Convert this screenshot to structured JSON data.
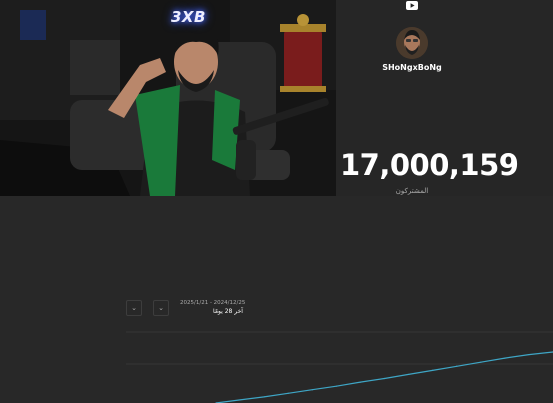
{
  "photo": {
    "logo_text": "3XB"
  },
  "channel": {
    "platform_icon": "youtube-icon",
    "name": "SHoNgxBoNg",
    "subscriber_count": "17,000,159",
    "subscriber_label": "المشتركون"
  },
  "range": {
    "dates": "2025/1/21 - 2024/12/25",
    "label": "آخر 28 يومًا"
  },
  "chart_data": {
    "type": "line",
    "title": "",
    "xlabel": "",
    "ylabel": "",
    "series": [
      {
        "values": [
          0.0,
          0.06,
          0.12,
          0.19,
          0.26,
          0.33,
          0.41,
          0.48,
          0.56,
          0.64,
          0.72,
          0.8,
          0.88,
          0.95,
          1.0
        ]
      }
    ],
    "grid": true,
    "color": "#3ea6c6"
  },
  "colors": {
    "background": "#282828",
    "line": "#3ea6c6",
    "muted_text": "#aaaaaa"
  }
}
